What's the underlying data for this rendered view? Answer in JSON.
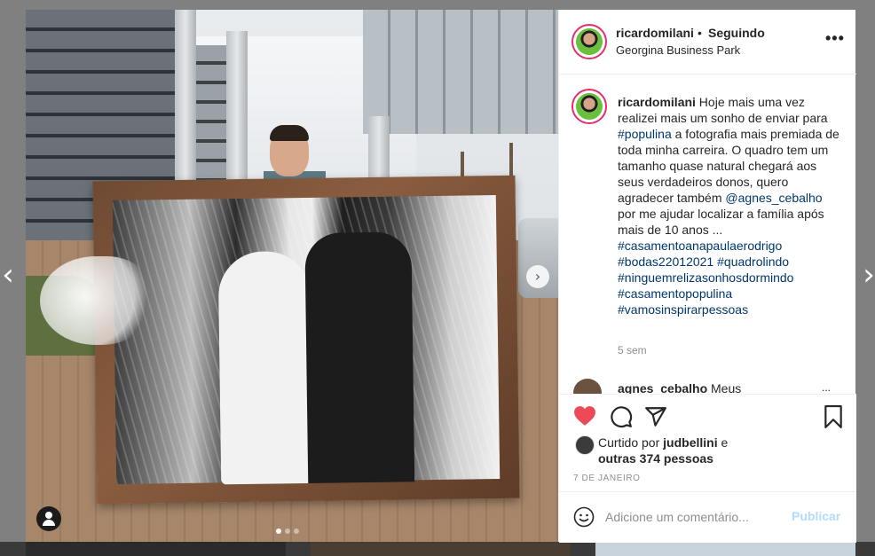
{
  "post": {
    "username": "ricardomilani",
    "separator": "•",
    "follow_status": "Seguindo",
    "location": "Georgina Business Park",
    "more_label": "•••",
    "caption": {
      "author": "ricardomilani",
      "text_1": " Hoje mais uma vez realizei mais um sonho de enviar para ",
      "tag_populina": "#populina",
      "text_2": " a fotografia mais premiada de toda minha carreira. O quadro tem um tamanho quase natural chegará aos seus verdadeiros donos, quero agradecer também ",
      "mention": "@agnes_cebalho",
      "text_3": " por me ajudar localizar a família após mais de 10 anos ...",
      "hashtags": [
        "#casamentoanapaulaerodrigo",
        "#bodas22012021",
        "#quadrolindo",
        "#ninguemrelizasonhosdormindo",
        "#casamentopopulina",
        "#vamosinspirarpessoas"
      ]
    },
    "time_ago": "5 sem",
    "reply": {
      "user": "agnes_cebalho",
      "text": "Meus",
      "more": "..."
    },
    "likes": {
      "prefix": "Curtido por",
      "user": "judbellini",
      "conj": "e",
      "others": "outras 374 pessoas"
    },
    "date": "7 DE JANEIRO",
    "comment_placeholder": "Adicione um comentário...",
    "publish_label": "Publicar",
    "carousel": {
      "count": 3,
      "active_index": 0
    }
  },
  "icons": {
    "prev": "chevron-left-icon",
    "next": "chevron-right-icon",
    "like": "heart-icon",
    "comment": "comment-icon",
    "share": "share-icon",
    "save": "bookmark-icon",
    "emoji": "emoji-icon",
    "tag": "user-tag-icon"
  },
  "colors": {
    "like_red": "#ed4956",
    "hashtag_blue": "#00376b",
    "publish_disabled": "#b3dbff",
    "story_ring": "#e1306c"
  }
}
